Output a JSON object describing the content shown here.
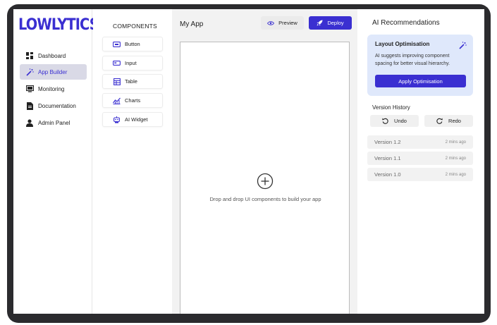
{
  "brand": {
    "logo_text": "LOWLYTICS"
  },
  "sidebar": {
    "items": [
      {
        "label": "Dashboard",
        "icon": "dashboard-grid-icon"
      },
      {
        "label": "App Builder",
        "icon": "magic-wand-icon",
        "active": true
      },
      {
        "label": "Monitoring",
        "icon": "monitor-icon"
      },
      {
        "label": "Documentation",
        "icon": "document-icon"
      },
      {
        "label": "Admin Panel",
        "icon": "user-icon"
      }
    ]
  },
  "components": {
    "title": "COMPONENTS",
    "items": [
      {
        "label": "Button",
        "icon": "button-icon"
      },
      {
        "label": "Input",
        "icon": "input-icon"
      },
      {
        "label": "Table",
        "icon": "table-icon"
      },
      {
        "label": "Charts",
        "icon": "chart-icon"
      },
      {
        "label": "AI Widget",
        "icon": "robot-icon"
      }
    ]
  },
  "canvas": {
    "app_title": "My App",
    "preview_label": "Preview",
    "deploy_label": "Deploy",
    "drop_hint": "Drop and drop UI components to build your app"
  },
  "ai": {
    "title": "AI Recommendations",
    "card": {
      "title": "Layout Optimisation",
      "description": "AI suggests improving component spacing for better visual hierarchy.",
      "apply_label": "Apply Optimisation"
    },
    "version_history": {
      "title": "Version History",
      "undo_label": "Undo",
      "redo_label": "Redo",
      "versions": [
        {
          "name": "Version 1.2",
          "time": "2 mins ago"
        },
        {
          "name": "Version 1.1",
          "time": "2 mins ago"
        },
        {
          "name": "Version 1.0",
          "time": "2 mins ago"
        }
      ]
    }
  },
  "colors": {
    "accent": "#3a2fd1",
    "card_bg": "#dfe8fb",
    "canvas_bg": "#f2f2f2"
  }
}
